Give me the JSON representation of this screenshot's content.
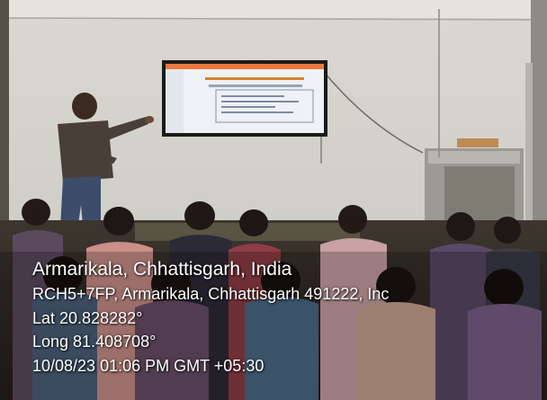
{
  "geotag": {
    "place": "Armarikala, Chhattisgarh, India",
    "address": "RCH5+7FP, Armarikala, Chhattisgarh 491222, Inc",
    "latitude": "Lat 20.828282°",
    "longitude": "Long 81.408708°",
    "datetime": "10/08/23 01:06 PM GMT +05:30"
  },
  "scene": {
    "depicts": [
      "presenter",
      "wall-mounted display",
      "seated audience"
    ],
    "colors": {
      "wall": "#d2d1c9",
      "screen_header": "#e9793d",
      "screen_body": "#eef1f5",
      "overlay_text": "#ffffff"
    }
  }
}
